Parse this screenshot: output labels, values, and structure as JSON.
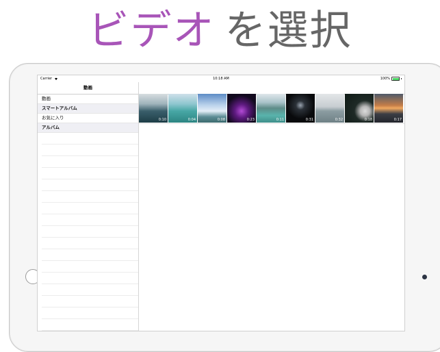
{
  "headline": {
    "accent": "ビデオ",
    "rest": "を選択"
  },
  "status_bar": {
    "carrier": "Carrier",
    "time": "10:18 AM",
    "battery": "100%"
  },
  "sidebar": {
    "title": "動画",
    "items": [
      {
        "label": "動画",
        "type": "item"
      },
      {
        "label": "スマートアルバム",
        "type": "header"
      },
      {
        "label": "お気に入り",
        "type": "item"
      },
      {
        "label": "アルバム",
        "type": "header"
      }
    ]
  },
  "videos": [
    {
      "duration": "0:10"
    },
    {
      "duration": "0:04"
    },
    {
      "duration": "0:08"
    },
    {
      "duration": "0:23"
    },
    {
      "duration": "0:11"
    },
    {
      "duration": "0:31"
    },
    {
      "duration": "0:32"
    },
    {
      "duration": "0:18"
    },
    {
      "duration": "0:17"
    }
  ],
  "colors": {
    "accent": "#a855b8",
    "battery": "#4cd964",
    "section_header_bg": "#efeff4"
  }
}
